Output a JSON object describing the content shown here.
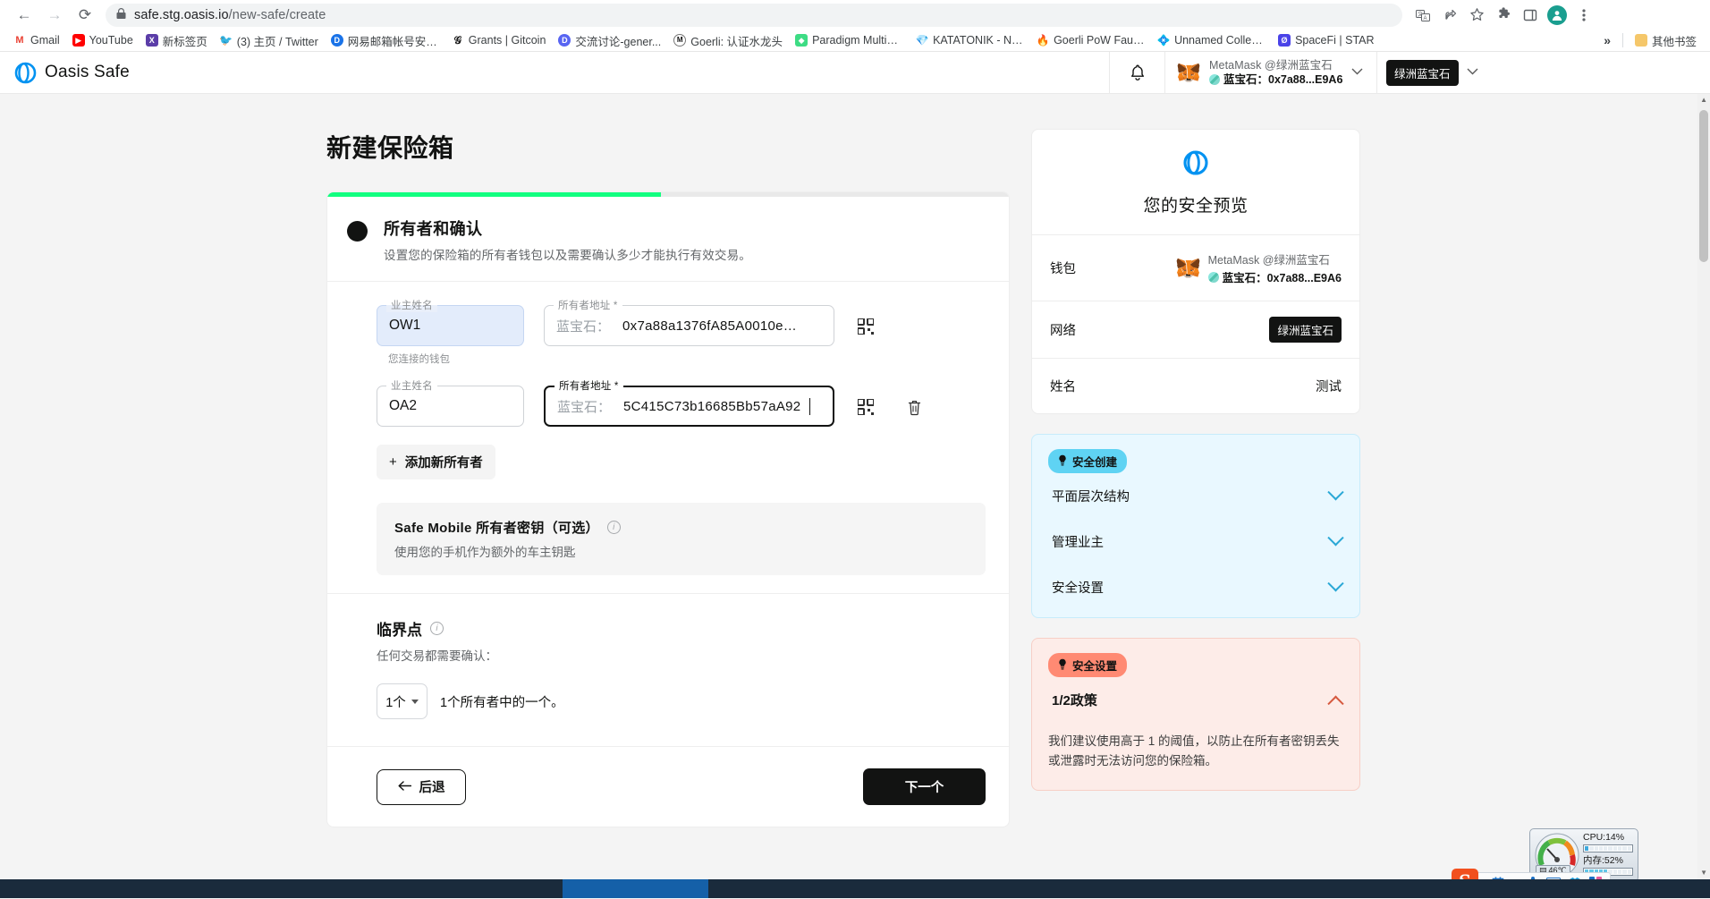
{
  "browser": {
    "url_host": "safe.stg.oasis.io",
    "url_path": "/new-safe/create",
    "back_icon": "←",
    "forward_icon": "→",
    "reload_icon": "⟳",
    "lock_icon": "🔒",
    "toolbar_icons": [
      "translate-icon",
      "share-icon",
      "bookmark-star-icon",
      "extensions-puzzle-icon",
      "sidepanel-icon",
      "profile-avatar",
      "chrome-menu-icon"
    ],
    "bookmarks": [
      {
        "label": "Gmail",
        "favicon": "M",
        "color": "#ea4335",
        "bg": "#ffffff"
      },
      {
        "label": "YouTube",
        "favicon": "▶",
        "color": "#ffffff",
        "bg": "#ff0000"
      },
      {
        "label": "新标签页",
        "favicon": "X",
        "color": "#ffffff",
        "bg": "#5b3da8"
      },
      {
        "label": "(3) 主页 / Twitter",
        "favicon": "t",
        "color": "#ffffff",
        "bg": "#1da1f2"
      },
      {
        "label": "网易邮箱帐号安全...",
        "favicon": "D",
        "color": "#ffffff",
        "bg": "#1a73e8"
      },
      {
        "label": "Grants | Gitcoin",
        "favicon": "G",
        "color": "#1a1a1a",
        "bg": "#ffffff"
      },
      {
        "label": "交流讨论-gener...",
        "favicon": "D",
        "color": "#ffffff",
        "bg": "#5865f2"
      },
      {
        "label": "Goerli: 认证水龙头",
        "favicon": "M",
        "color": "#1a1a1a",
        "bg": "#ffffff"
      },
      {
        "label": "Paradigm MultiFa...",
        "favicon": "◆",
        "color": "#ffffff",
        "bg": "#3ddc84"
      },
      {
        "label": "KATATONIK - NFT...",
        "favicon": "◆",
        "color": "#ffffff",
        "bg": "#c724ff"
      },
      {
        "label": "Goerli PoW Faucet",
        "favicon": "◆",
        "color": "#ffffff",
        "bg": "#f06a3a"
      },
      {
        "label": "Unnamed Collecti...",
        "favicon": "◆",
        "color": "#ffffff",
        "bg": "#f0568c"
      },
      {
        "label": "SpaceFi | STAR",
        "favicon": "Ø",
        "color": "#ffffff",
        "bg": "#4a43e8"
      }
    ],
    "overflow_icon": "»",
    "other_bookmarks_label": "其他书签",
    "other_bookmarks_icon": "folder-icon"
  },
  "app_header": {
    "brand": "Oasis Safe",
    "brand_icon": "oasis-logo",
    "bell_icon": "notification-bell-icon",
    "wallet": {
      "name": "MetaMask @绿洲蓝宝石",
      "account": "蓝宝石：0x7a88...E9A6",
      "icon": "metamask-fox-icon",
      "caret": "chevron-down-icon"
    },
    "network": {
      "label": "绿洲蓝宝石",
      "caret": "chevron-down-icon"
    }
  },
  "main": {
    "page_title": "新建保险箱",
    "progress_percent": 49,
    "step": {
      "title": "所有者和确认",
      "description": "设置您的保险箱的所有者钱包以及需要确认多少才能执行有效交易。"
    },
    "owners": [
      {
        "name_legend": "业主姓名",
        "name_value": "OW1",
        "addr_legend": "所有者地址 *",
        "addr_prefix": "蓝宝石：",
        "addr_value": "0x7a88a1376fA85A0010e…",
        "helper": "您连接的钱包",
        "qr_icon": "qr-code-icon",
        "focused": false,
        "deletable": false
      },
      {
        "name_legend": "业主姓名",
        "name_value": "OA2",
        "addr_legend": "所有者地址 *",
        "addr_prefix": "蓝宝石：",
        "addr_value": "5C415C73b16685Bb57aA92",
        "helper": "",
        "qr_icon": "qr-code-icon",
        "delete_icon": "trash-icon",
        "focused": true,
        "deletable": true
      }
    ],
    "add_owner_label": "添加新所有者",
    "add_owner_icon": "plus-icon",
    "mobile_key": {
      "title": "Safe Mobile 所有者密钥（可选）",
      "subtitle": "使用您的手机作为额外的车主钥匙",
      "info_icon": "info-icon"
    },
    "threshold": {
      "title": "临界点",
      "info_icon": "info-icon",
      "subtitle": "任何交易都需要确认：",
      "selected": "1个",
      "caret_icon": "chevron-down-icon",
      "description": "1个所有者中的一个。"
    },
    "back_label": "后退",
    "back_icon": "arrow-left-icon",
    "next_label": "下一个"
  },
  "sidebar": {
    "preview_title": "您的安全预览",
    "preview_logo": "oasis-logo",
    "rows": [
      {
        "key": "钱包",
        "type": "wallet",
        "name": "MetaMask @绿洲蓝宝石",
        "account": "蓝宝石：0x7a88...E9A6"
      },
      {
        "key": "网络",
        "type": "pill",
        "value": "绿洲蓝宝石"
      },
      {
        "key": "姓名",
        "type": "text",
        "value": "测试"
      }
    ],
    "tip_blue": {
      "tag": "安全创建",
      "tag_icon": "lightbulb-icon",
      "items": [
        {
          "label": "平面层次结构",
          "caret": "chevron-down-icon"
        },
        {
          "label": "管理业主",
          "caret": "chevron-down-icon"
        },
        {
          "label": "安全设置",
          "caret": "chevron-down-icon"
        }
      ]
    },
    "tip_red": {
      "tag": "安全设置",
      "tag_icon": "lightbulb-icon",
      "policy": "1/2政策",
      "caret": "chevron-up-icon",
      "body": "我们建议使用高于 1 的阈值，以防止在所有者密钥丢失或泄露时无法访问您的保险箱。"
    }
  },
  "desktop": {
    "sysmon": {
      "cpu_label": "CPU:14%",
      "cpu_percent": 14,
      "mem_label": "内存:52%",
      "mem_percent": 52,
      "temp": "46℃",
      "temp_icon": "thermometer-icon"
    },
    "ime": {
      "logo": "sogou-s-icon",
      "mode": "英",
      "icons": [
        "punctuation-icon",
        "microphone-icon",
        "keyboard-icon",
        "skin-icon",
        "apps-icon"
      ]
    }
  }
}
